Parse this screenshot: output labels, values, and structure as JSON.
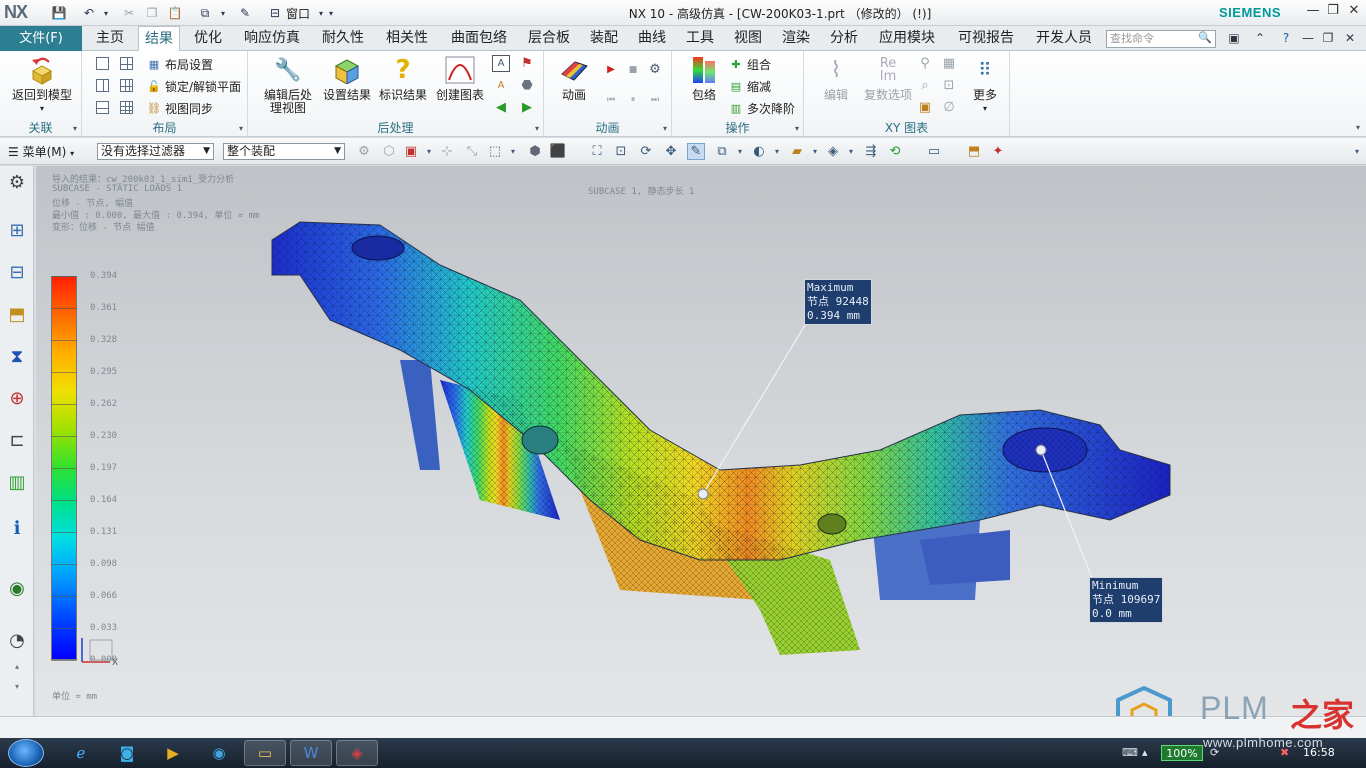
{
  "title_bar": {
    "logo": "NX",
    "window_title": "NX 10 - 高级仿真 - [CW-200K03-1.prt （修改的）  (!)]",
    "brand": "SIEMENS",
    "window_menu_label": "窗口",
    "minimize": "—",
    "restore": "❐",
    "close": "✕"
  },
  "menu_tabs": {
    "file": "文件(F)",
    "items": [
      "主页",
      "结果",
      "优化",
      "响应仿真",
      "耐久性",
      "相关性",
      "曲面包络",
      "层合板",
      "装配",
      "曲线",
      "工具",
      "视图",
      "渲染",
      "分析",
      "应用模块",
      "可视报告",
      "开发人员"
    ],
    "active": "结果",
    "search_placeholder": "查找命令"
  },
  "ribbon": {
    "link_group": {
      "label": "关联",
      "return_to_model": "返回到模型"
    },
    "layout_group": {
      "label": "布局",
      "layout_settings": "布局设置",
      "lock_unlock_plane": "锁定/解锁平面",
      "view_sync": "视图同步"
    },
    "postprocess_group": {
      "label": "后处理",
      "edit_post_view_line1": "编辑后处",
      "edit_post_view_line2": "理视图",
      "setup_results": "设置结果",
      "identify_results": "标识结果",
      "create_chart": "创建图表"
    },
    "animation_group": {
      "label": "动画",
      "animation": "动画"
    },
    "operation_group": {
      "label": "操作",
      "envelope": "包络",
      "combine": "组合",
      "reduce": "缩减",
      "multi_reduce": "多次降阶"
    },
    "xy_chart_group": {
      "label": "XY 图表",
      "edit": "编辑",
      "complex_options": "复数选项",
      "more": "更多"
    }
  },
  "toolbar2": {
    "menu_label": "菜单(M)",
    "selection_filter": "没有选择过滤器",
    "assembly_scope": "整个装配"
  },
  "graphics": {
    "info_lines": [
      "导入的结果：cw_200k03_1_sim1_受力分析",
      "SUBCASE - STATIC LOADS 1",
      "位移 - 节点, 幅值",
      "最小值 : 0.000, 最大值 : 0.394, 单位 = mm",
      "变形：位移 - 节点 幅值"
    ],
    "subcase_title": "SUBCASE 1, 静态步长 1",
    "legend_values": [
      "0.394",
      "0.361",
      "0.328",
      "0.295",
      "0.262",
      "0.230",
      "0.197",
      "0.164",
      "0.131",
      "0.098",
      "0.066",
      "0.033",
      "0.000"
    ],
    "legend_unit": "单位 = mm",
    "max_tag": {
      "title": "Maximum",
      "node": "节点 92448",
      "value": "0.394 mm"
    },
    "min_tag": {
      "title": "Minimum",
      "node": "节点 109697",
      "value": "0.0 mm"
    },
    "triad_x": "X"
  },
  "watermark": {
    "brand_latin": "PLM",
    "brand_cn": "之家",
    "url": "www.plmhome.com"
  },
  "taskbar": {
    "zoom": "100%",
    "clock": "16:58"
  }
}
